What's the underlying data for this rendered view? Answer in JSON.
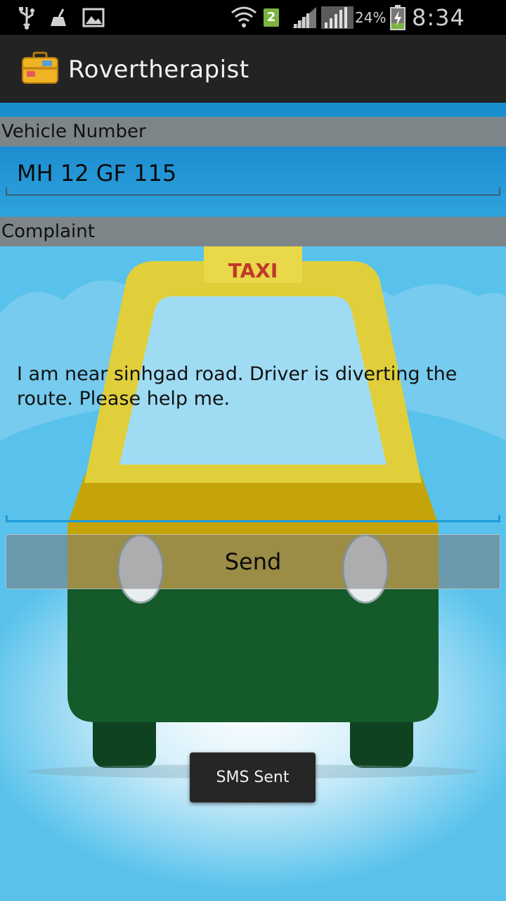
{
  "status_bar": {
    "battery_percent": "24%",
    "time": "8:34 PM",
    "sim_slot": "2",
    "icons": [
      "usb-icon",
      "cleanup-icon",
      "gallery-icon",
      "wifi-icon",
      "signal-icon",
      "signal-full-icon",
      "battery-charging-icon"
    ]
  },
  "action_bar": {
    "app_title": "Rovertherapist",
    "app_icon": "suitcase-icon"
  },
  "form": {
    "vehicle_label": "Vehicle Number",
    "vehicle_value": "MH 12 GF 115",
    "complaint_label": "Complaint",
    "complaint_value": "I am near sinhgad road. Driver is diverting the route. Please help me.",
    "send_label": "Send"
  },
  "background_art": {
    "sign_text": "TAXI"
  },
  "toast": {
    "message": "SMS Sent"
  },
  "colors": {
    "label_bar": "#808080",
    "accent": "#1f9bd8",
    "taxi_yellow": "#e6d23c",
    "taxi_green": "#155a2a"
  }
}
